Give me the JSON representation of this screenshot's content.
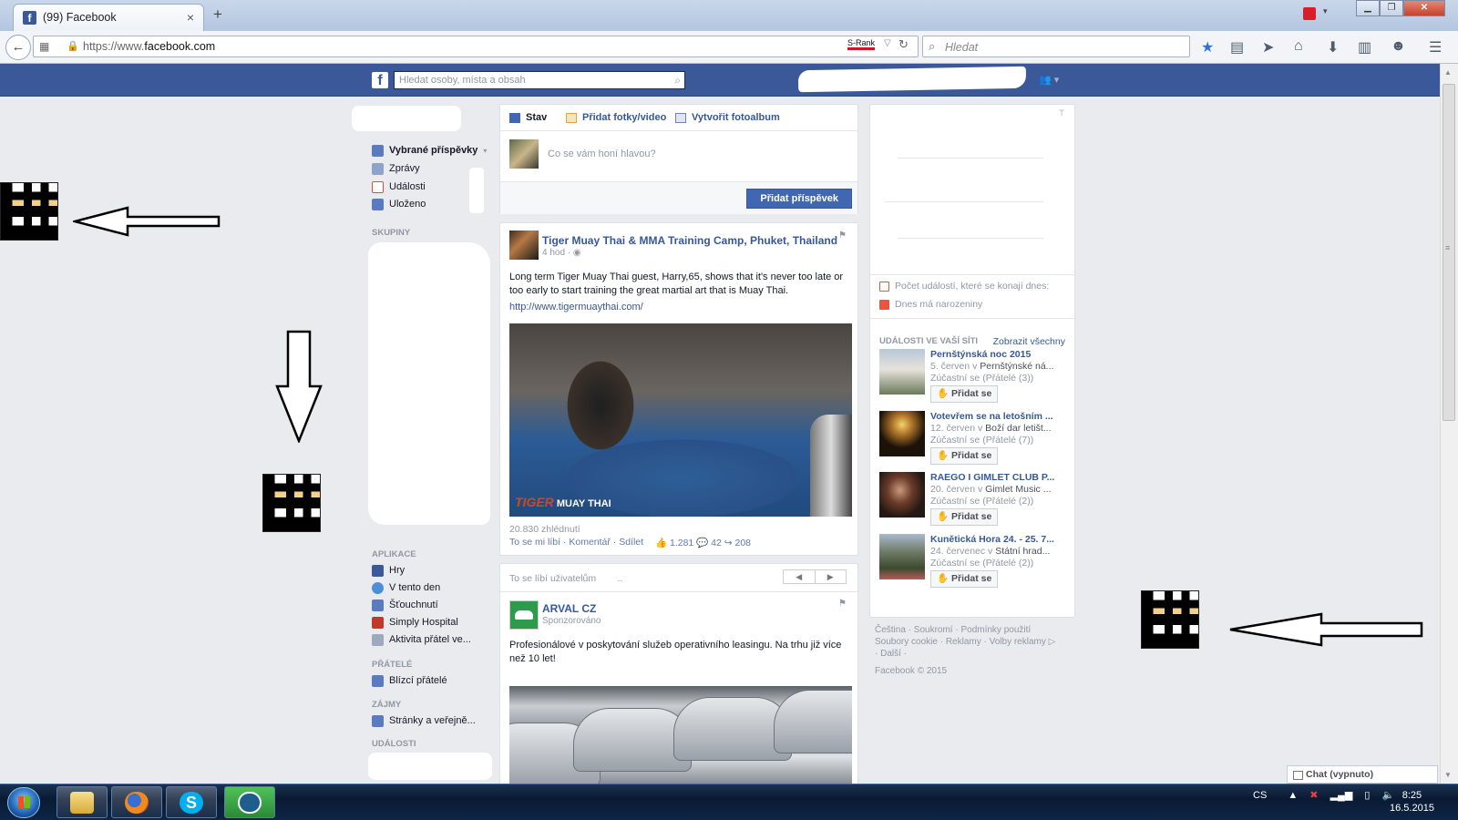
{
  "browser": {
    "tab_title": "(99) Facebook",
    "tab_close": "×",
    "new_tab": "+",
    "url_prefix": "https://www.",
    "url_host": "facebook.com",
    "srank_label": "S-Rank",
    "search_placeholder": "Hledat"
  },
  "facebook": {
    "search_placeholder": "Hledat osoby, místa a obsah",
    "left_nav": {
      "favorites": [
        {
          "label": "Vybrané příspěvky",
          "icon": "news-feed-icon",
          "color": "#5b7bc0"
        },
        {
          "label": "Zprávy",
          "icon": "messages-icon",
          "color": "#8ea3cc"
        },
        {
          "label": "Události",
          "icon": "events-icon",
          "color": "#e04b3b"
        },
        {
          "label": "Uloženo",
          "icon": "saved-icon",
          "color": "#5b7bc0"
        }
      ],
      "groups_heading": "SKUPINY",
      "apps_heading": "APLIKACE",
      "apps": [
        {
          "label": "Hry",
          "icon": "games-icon",
          "color": "#3b5998"
        },
        {
          "label": "V tento den",
          "icon": "on-this-day-icon",
          "color": "#4a90d9"
        },
        {
          "label": "Šťouchnutí",
          "icon": "poke-icon",
          "color": "#5b7bc0"
        },
        {
          "label": "Simply Hospital",
          "icon": "simply-hospital-icon",
          "color": "#c0392b"
        },
        {
          "label": "Aktivita přátel ve...",
          "icon": "friends-activity-icon",
          "color": "#9fa9be"
        }
      ],
      "friends_heading": "PŘÁTELÉ",
      "friends": [
        {
          "label": "Blízcí přátelé",
          "icon": "close-friends-icon",
          "color": "#5b7bc0"
        }
      ],
      "interests_heading": "ZÁJMY",
      "interests": [
        {
          "label": "Stránky a veřejně...",
          "icon": "pages-icon",
          "color": "#5b7bc0"
        }
      ],
      "events_heading": "UDÁLOSTI"
    },
    "composer": {
      "tab_status": "Stav",
      "tab_photo": "Přidat fotky/video",
      "tab_album": "Vytvořit fotoalbum",
      "placeholder": "Co se vám honí hlavou?",
      "post_button": "Přidat příspěvek"
    },
    "post1": {
      "page_name": "Tiger Muay Thai & MMA Training Camp, Phuket, Thailand",
      "time": "4 hod · ◉",
      "text": "Long term Tiger Muay Thai guest, Harry,65, shows that it's never too late or too early to start training the great martial art that is Muay Thai.",
      "link": "http://www.tigermuaythai.com/",
      "video_logo_main": "TIGER",
      "video_logo_sub": " MUAY THAI",
      "views": "20.830 zhlédnutí",
      "actions": "To se mi líbí · Komentář · Sdílet",
      "stats": "👍 1.281  💬 42  ↪ 208"
    },
    "post2": {
      "liked_by": "To se líbí uživatelům",
      "page_name": "ARVAL CZ",
      "sponsored": "Sponzorováno",
      "text": "Profesionálové v poskytování služeb operativního leasingu. Na trhu již více než 10 let!"
    },
    "right": {
      "events_today": "Počet událostí, které se konají dnes:",
      "birthdays": "Dnes má narozeniny",
      "events_heading": "UDÁLOSTI VE VAŠÍ SÍTI",
      "show_all": "Zobrazit všechny",
      "join_label": "✋ Přidat se",
      "events": [
        {
          "title": "Pernštýnská noc 2015",
          "date": "5. červen v ",
          "place": "Pernštýnské ná...",
          "friends": "Zúčastní se (Přátelé (3))"
        },
        {
          "title": "Votevřem se na letošním ...",
          "date": "12. červen v ",
          "place": "Boží dar letišt...",
          "friends": "Zúčastní se (Přátelé (7))"
        },
        {
          "title": "RAEGO I GIMLET CLUB P...",
          "date": "20. červen v ",
          "place": "Gimlet Music ...",
          "friends": "Zúčastní se (Přátelé (2))"
        },
        {
          "title": "Kunětická Hora 24. - 25. 7...",
          "date": "24. červenec v ",
          "place": "Státní hrad...",
          "friends": "Zúčastní se (Přátelé (2))"
        }
      ]
    },
    "footer": {
      "line1": "Čeština · Soukromí · Podmínky použití",
      "line2": "Soubory cookie · Reklamy · Volby reklamy ▷",
      "line3": "· Další ·",
      "copyright": "Facebook © 2015"
    },
    "chat": "Chat (vypnuto)"
  },
  "taskbar": {
    "language": "CS",
    "time": "8:25",
    "date": "16.5.2015"
  }
}
